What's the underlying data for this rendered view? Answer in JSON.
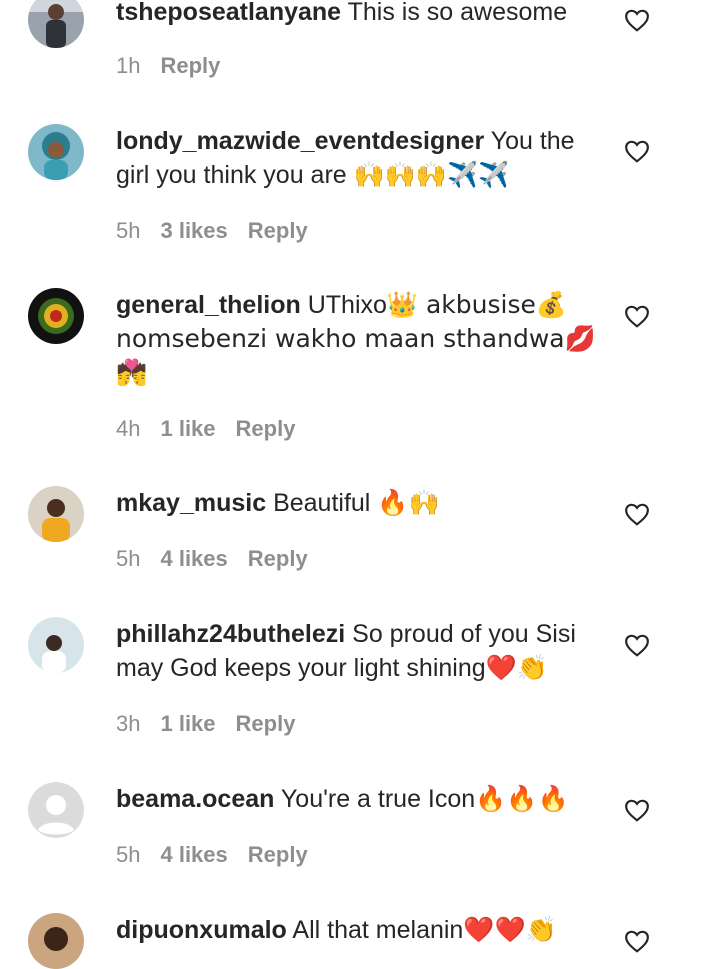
{
  "comments": [
    {
      "username": "tsheposeatlanyane",
      "text": "This is so awesome",
      "emoji": "",
      "time": "1h",
      "likes": "",
      "reply": "Reply",
      "avatar_icon": "person-photo"
    },
    {
      "username": "londy_mazwide_eventdesigner",
      "text": "You the girl you think you are",
      "emoji": "🙌🙌🙌✈️✈️",
      "time": "5h",
      "likes": "3 likes",
      "reply": "Reply",
      "avatar_icon": "person-photo"
    },
    {
      "username": "general_thelion",
      "text": "UThixo",
      "emoji": "👑 akbusise💰 nomsebenzi wakho maan sthandwa💋 💏",
      "time": "4h",
      "likes": "1 like",
      "reply": "Reply",
      "avatar_icon": "riddim-logo"
    },
    {
      "username": "mkay_music",
      "text": "Beautiful",
      "emoji": "🔥🙌",
      "time": "5h",
      "likes": "4 likes",
      "reply": "Reply",
      "avatar_icon": "person-photo"
    },
    {
      "username": "phillahz24buthelezi",
      "text": "So proud of you Sisi may God keeps your light shining",
      "emoji": "❤️👏",
      "time": "3h",
      "likes": "1 like",
      "reply": "Reply",
      "avatar_icon": "person-photo"
    },
    {
      "username": "beama.ocean",
      "text": "You're a true Icon",
      "emoji": "🔥🔥🔥",
      "time": "5h",
      "likes": "4 likes",
      "reply": "Reply",
      "avatar_icon": "default-avatar"
    },
    {
      "username": "dipuonxumalo",
      "text": "All that melanin",
      "emoji": "❤️❤️👏",
      "time": "",
      "likes": "",
      "reply": "",
      "avatar_icon": "person-photo"
    }
  ],
  "icons": {
    "like": "heart-outline-icon"
  },
  "colors": {
    "text": "#262626",
    "meta": "#8e8e8e",
    "background": "#ffffff"
  }
}
